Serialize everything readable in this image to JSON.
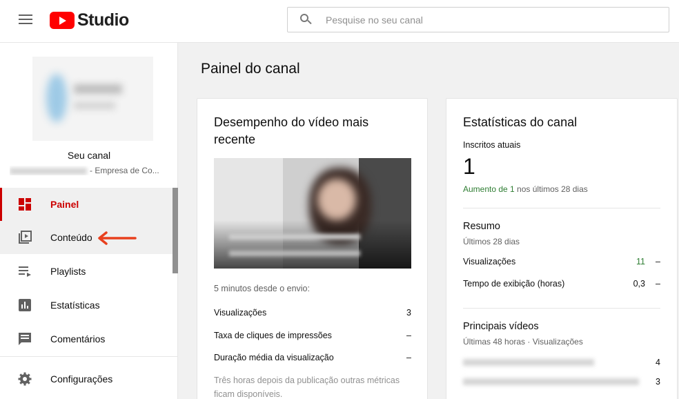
{
  "header": {
    "logo_text": "Studio",
    "search_placeholder": "Pesquise no seu canal"
  },
  "sidebar": {
    "channel_label": "Seu canal",
    "channel_subtitle": "- Empresa de Co...",
    "items": [
      {
        "label": "Painel",
        "icon": "dashboard-icon"
      },
      {
        "label": "Conteúdo",
        "icon": "content-icon"
      },
      {
        "label": "Playlists",
        "icon": "playlist-icon"
      },
      {
        "label": "Estatísticas",
        "icon": "analytics-icon"
      },
      {
        "label": "Comentários",
        "icon": "comment-icon"
      },
      {
        "label": "Configurações",
        "icon": "gear-icon"
      }
    ],
    "accent_color": "#cc0000",
    "annotation_arrow_color": "#e8401e"
  },
  "main": {
    "page_title": "Painel do canal",
    "latest_video": {
      "title": "Desempenho do vídeo mais recente",
      "since_upload": "5 minutos desde o envio:",
      "metrics": [
        {
          "label": "Visualizações",
          "value": "3"
        },
        {
          "label": "Taxa de cliques de impressões",
          "value": "–"
        },
        {
          "label": "Duração média da visualização",
          "value": "–"
        }
      ],
      "note": "Três horas depois da publicação outras métricas ficam disponíveis."
    },
    "channel_stats": {
      "title": "Estatísticas do canal",
      "subscribers_label": "Inscritos atuais",
      "subscribers_value": "1",
      "growth_prefix": "Aumento de 1",
      "growth_suffix": " nos últimos 28 dias",
      "summary_title": "Resumo",
      "summary_period": "Últimos 28 dias",
      "summary_rows": [
        {
          "label": "Visualizações",
          "value": "11",
          "trend": "–"
        },
        {
          "label": "Tempo de exibição (horas)",
          "value": "0,3",
          "trend": "–"
        }
      ],
      "top_videos_title": "Principais vídeos",
      "top_videos_period": "Últimas 48 horas · Visualizações",
      "top_videos": [
        {
          "views": "4"
        },
        {
          "views": "3"
        }
      ]
    }
  }
}
